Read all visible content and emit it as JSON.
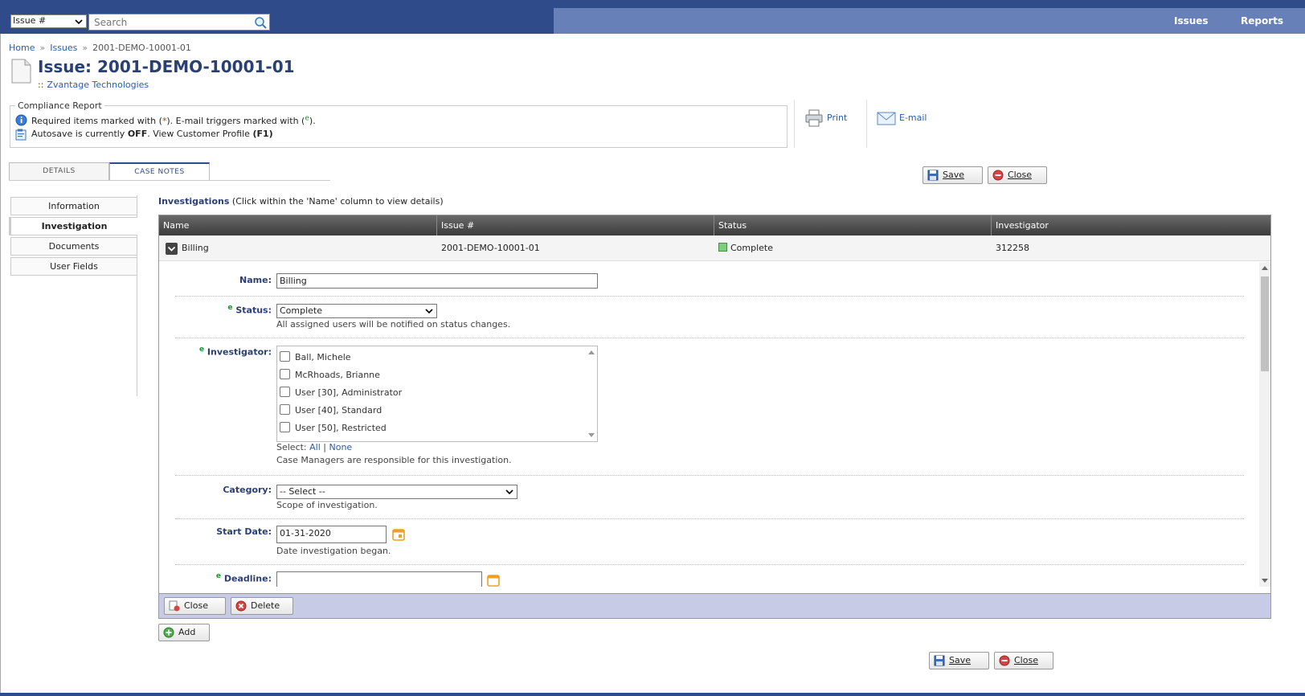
{
  "topbar": {
    "search_type": "Issue #",
    "search_placeholder": "Search",
    "nav": [
      "Issues",
      "Reports"
    ]
  },
  "breadcrumb": [
    "Home",
    "Issues",
    "2001-DEMO-10001-01"
  ],
  "page": {
    "title": "Issue: 2001-DEMO-10001-01",
    "org_prefix": "::",
    "org": "Zvantage Technologies"
  },
  "compliance": {
    "legend": "Compliance Report",
    "line1_a": "Required items marked with (",
    "line1_req": "*",
    "line1_b": "). E-mail triggers marked with (",
    "line1_e": "e",
    "line1_c": ").",
    "line2_a": "Autosave is currently",
    "line2_off": "OFF",
    "line2_b": ". View Customer Profile",
    "line2_f1": "(F1)"
  },
  "actions": {
    "print": "Print",
    "email": "E-mail"
  },
  "tabs": [
    "DETAILS",
    "CASE NOTES"
  ],
  "buttons": {
    "save": "Save",
    "close": "Close",
    "delete": "Delete",
    "add": "Add"
  },
  "side_menu": [
    "Information",
    "Investigation",
    "Documents",
    "User Fields"
  ],
  "investigations": {
    "heading": "Investigations",
    "hint": "(Click within the 'Name' column to view details)",
    "columns": [
      "Name",
      "Issue #",
      "Status",
      "Investigator"
    ],
    "row": {
      "name": "Billing",
      "issue": "2001-DEMO-10001-01",
      "status": "Complete",
      "investigator": "312258"
    }
  },
  "form": {
    "name_label": "Name:",
    "name_value": "Billing",
    "status_label": "Status:",
    "status_value": "Complete",
    "status_help": "All assigned users will be notified on status changes.",
    "investigator_label": "Investigator:",
    "investigators": [
      "Ball, Michele",
      "McRhoads, Brianne",
      "User [30], Administrator",
      "User [40], Standard",
      "User [50], Restricted"
    ],
    "select_label": "Select:",
    "select_all": "All",
    "select_sep": "|",
    "select_none": "None",
    "investigator_help": "Case Managers are responsible for this investigation.",
    "category_label": "Category:",
    "category_value": "-- Select --",
    "category_help": "Scope of investigation.",
    "start_label": "Start Date:",
    "start_value": "01-31-2020",
    "start_help": "Date investigation began.",
    "deadline_label": "Deadline:",
    "e_marker": "e"
  },
  "colors": {
    "header": "#2f4b8a",
    "nav_bg": "#6880b8",
    "title": "#2a3f73",
    "footer_bar": "#c7cbe6",
    "status_complete": "#7bcf7b"
  }
}
